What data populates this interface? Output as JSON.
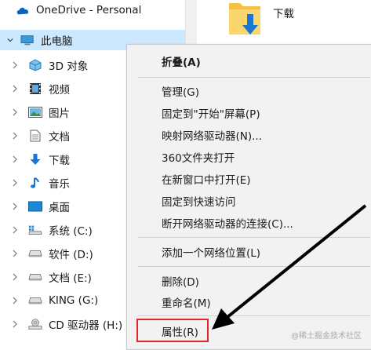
{
  "nav": {
    "items": [
      {
        "label": "OneDrive - Personal",
        "icon": "cloud-icon"
      },
      {
        "label": "此电脑",
        "icon": "computer-icon"
      },
      {
        "label": "3D 对象",
        "icon": "3d-objects-icon"
      },
      {
        "label": "视频",
        "icon": "video-icon"
      },
      {
        "label": "图片",
        "icon": "pictures-icon"
      },
      {
        "label": "文档",
        "icon": "documents-icon"
      },
      {
        "label": "下载",
        "icon": "downloads-icon"
      },
      {
        "label": "音乐",
        "icon": "music-icon"
      },
      {
        "label": "桌面",
        "icon": "desktop-icon"
      },
      {
        "label": "系统 (C:)",
        "icon": "system-drive-icon"
      },
      {
        "label": "软件 (D:)",
        "icon": "drive-icon"
      },
      {
        "label": "文档 (E:)",
        "icon": "drive-icon"
      },
      {
        "label": "KING (G:)",
        "icon": "drive-icon"
      },
      {
        "label": "CD 驱动器 (H:)",
        "icon": "cd-drive-icon"
      }
    ]
  },
  "content": {
    "folder_label": "下载"
  },
  "context_menu": {
    "items": [
      {
        "label": "折叠(A)"
      },
      {
        "label": "管理(G)"
      },
      {
        "label": "固定到\"开始\"屏幕(P)"
      },
      {
        "label": "映射网络驱动器(N)..."
      },
      {
        "label": "360文件夹打开"
      },
      {
        "label": "在新窗口中打开(E)"
      },
      {
        "label": "固定到快速访问"
      },
      {
        "label": "断开网络驱动器的连接(C)..."
      },
      {
        "label": "添加一个网络位置(L)"
      },
      {
        "label": "删除(D)"
      },
      {
        "label": "重命名(M)"
      },
      {
        "label": "属性(R)"
      }
    ]
  },
  "watermark": "@稀土掘金技术社区",
  "colors": {
    "selected_bg": "#cce8ff",
    "highlight_border": "#e0262a",
    "menu_bg": "#f2f2f2"
  }
}
